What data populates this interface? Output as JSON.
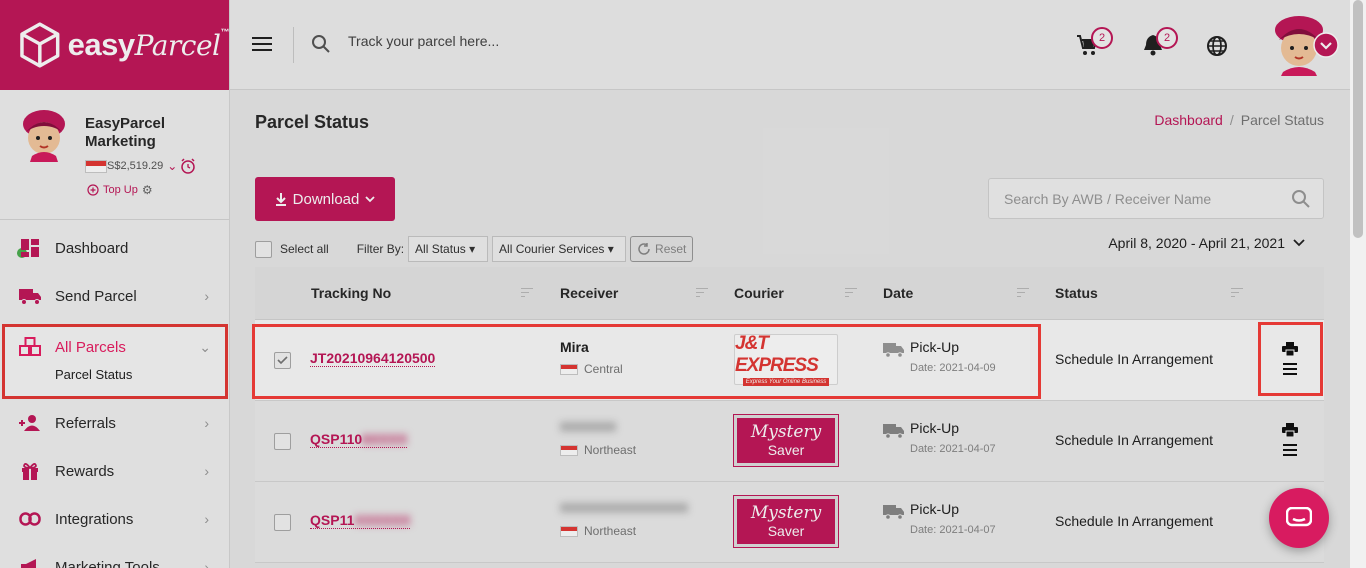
{
  "brand": {
    "name_bold": "easy",
    "name_script": "Parcel",
    "tm": "™",
    "color": "#c2185b"
  },
  "profile": {
    "name": "EasyParcel Marketing",
    "balance": "S$2,519.29",
    "topup_label": "Top Up"
  },
  "nav": {
    "dashboard": "Dashboard",
    "send_parcel": "Send Parcel",
    "all_parcels": "All Parcels",
    "parcel_status": "Parcel Status",
    "referrals": "Referrals",
    "rewards": "Rewards",
    "integrations": "Integrations",
    "marketing_tools": "Marketing Tools"
  },
  "topbar": {
    "search_placeholder": "Track your parcel here...",
    "cart_count": "2",
    "notif_count": "2"
  },
  "page": {
    "title": "Parcel Status",
    "breadcrumb": {
      "home": "Dashboard",
      "sep": "/",
      "current": "Parcel Status"
    },
    "download_label": "Download",
    "awb_placeholder": "Search By AWB / Receiver Name",
    "select_all": "Select all",
    "filter_by": "Filter By:",
    "status_filter": "All Status",
    "courier_filter": "All Courier Services",
    "reset": "Reset",
    "date_range": "April 8, 2020 - April 21, 2021"
  },
  "table": {
    "headers": {
      "tracking": "Tracking No",
      "receiver": "Receiver",
      "courier": "Courier",
      "date": "Date",
      "status": "Status"
    },
    "rows": [
      {
        "tracking": "JT20210964120500",
        "receiver": "Mira",
        "region": "Central",
        "courier": "J&T EXPRESS",
        "courier_tagline": "Express Your Online Business",
        "date_type": "Pick-Up",
        "date": "Date: 2021-04-09",
        "status": "Schedule In Arrangement"
      },
      {
        "tracking": "QSP110",
        "tracking_hidden": "6XXXX",
        "receiver": "XXXXXXX",
        "region": "Northeast",
        "courier": "Mystery Saver",
        "date_type": "Pick-Up",
        "date": "Date: 2021-04-07",
        "status": "Schedule In Arrangement"
      },
      {
        "tracking": "QSP11",
        "tracking_hidden": "XXXXXX",
        "receiver": "XXXXXXXXXXXXXXXX",
        "region": "Northeast",
        "courier": "Mystery Saver",
        "date_type": "Pick-Up",
        "date": "Date: 2021-04-07",
        "status": "Schedule In Arrangement"
      }
    ]
  },
  "mystery_logo": {
    "line1": "Mystery",
    "line2": "Saver"
  }
}
